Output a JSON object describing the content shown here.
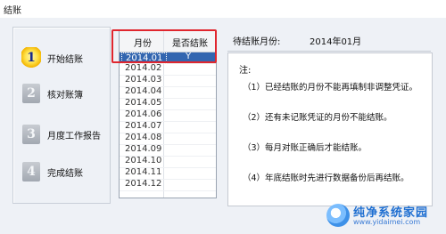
{
  "window": {
    "title": "结账"
  },
  "steps": [
    {
      "num": "1",
      "label": "开始结账",
      "active": true
    },
    {
      "num": "2",
      "label": "核对账簿",
      "active": false
    },
    {
      "num": "3",
      "label": "月度工作报告",
      "active": false
    },
    {
      "num": "4",
      "label": "完成结账",
      "active": false
    }
  ],
  "table": {
    "headers": [
      "月份",
      "是否结账"
    ],
    "rows": [
      {
        "month": "2014.01",
        "closed": "Y",
        "selected": true
      },
      {
        "month": "2014.02",
        "closed": ""
      },
      {
        "month": "2014.03",
        "closed": ""
      },
      {
        "month": "2014.04",
        "closed": ""
      },
      {
        "month": "2014.05",
        "closed": ""
      },
      {
        "month": "2014.06",
        "closed": ""
      },
      {
        "month": "2014.07",
        "closed": ""
      },
      {
        "month": "2014.08",
        "closed": ""
      },
      {
        "month": "2014.09",
        "closed": ""
      },
      {
        "month": "2014.10",
        "closed": ""
      },
      {
        "month": "2014.11",
        "closed": ""
      },
      {
        "month": "2014.12",
        "closed": ""
      }
    ]
  },
  "pending": {
    "label": "待结账月份:",
    "value": "2014年01月"
  },
  "notes": {
    "heading": "注:",
    "items": [
      "（1）已经结账的月份不能再填制非调整凭证。",
      "（2）还有未记账凭证的月份不能结账。",
      "（3）每月对账正确后才能结账。",
      "（4）年底结账时先进行数据备份后再结账。"
    ]
  },
  "watermark": {
    "name": "纯净系统家园",
    "url": "www.yidaimei.com"
  }
}
